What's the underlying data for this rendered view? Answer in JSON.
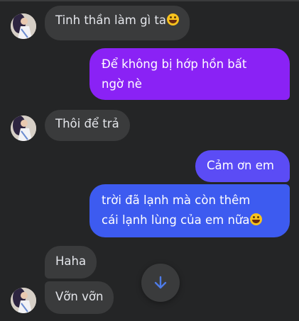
{
  "colors": {
    "background": "#242526",
    "incoming_bubble": "#3a3b3c",
    "outgoing_purple": "#8a22f5",
    "outgoing_blue_top": "#5b4cf5",
    "outgoing_blue_bottom": "#3d5bf0",
    "icon_accent": "#4e7be8"
  },
  "messages": [
    {
      "direction": "incoming",
      "text": "Tinh thần làm gì ta",
      "emoji": "grinning-face-emoji"
    },
    {
      "direction": "outgoing",
      "line1": "Để không bị hớp hồn bất",
      "line2": "ngờ nè"
    },
    {
      "direction": "incoming",
      "text": "Thôi để trả"
    },
    {
      "direction": "outgoing",
      "text": "Cảm ơn em"
    },
    {
      "direction": "outgoing",
      "line1": "trời đã lạnh mà còn thêm",
      "line2": "cái lạnh lùng của em nữa",
      "emoji": "grinning-face-emoji"
    },
    {
      "direction": "incoming",
      "text": "Haha"
    },
    {
      "direction": "incoming",
      "text": "Vỡn vỡn"
    }
  ],
  "scroll_button": {
    "icon": "arrow-down-icon"
  }
}
